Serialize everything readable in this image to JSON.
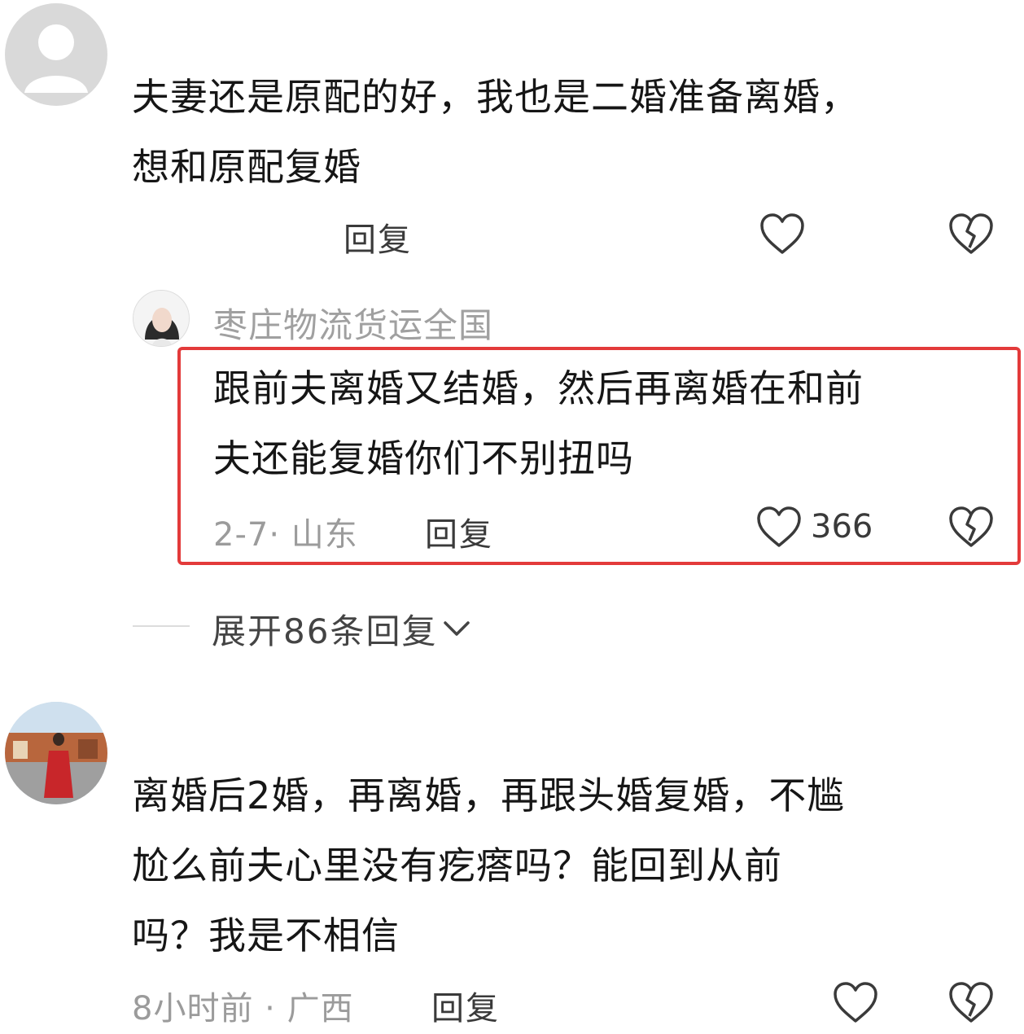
{
  "comments": [
    {
      "text_lines": [
        "夫妻还是原配的好，我也是二婚准备离婚，",
        "想和原配复婚"
      ],
      "reply_label": "回复"
    },
    {
      "username": "枣庄物流货运全国",
      "text_lines": [
        "跟前夫离婚又结婚，然后再离婚在和前",
        "夫还能复婚你们不别扭吗"
      ],
      "meta": "2-7· 山东",
      "reply_label": "回复",
      "like_count": "366"
    },
    {
      "text_lines": [
        "离婚后2婚，再离婚，再跟头婚复婚，不尴",
        "尬么前夫心里没有疙瘩吗？能回到从前",
        "吗？我是不相信"
      ],
      "meta": "8小时前 · 广西",
      "reply_label": "回复"
    }
  ],
  "expand_replies": {
    "label": "展开86条回复"
  },
  "colors": {
    "highlight": "#e33a3a",
    "meta": "#9b9b9b"
  },
  "icons": [
    "avatar-placeholder-icon",
    "heart-icon",
    "broken-heart-icon",
    "chevron-down-icon"
  ]
}
